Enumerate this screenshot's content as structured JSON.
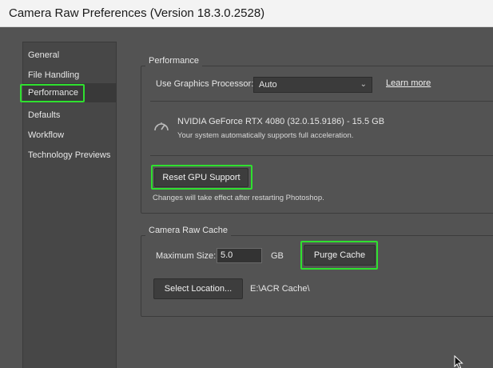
{
  "window": {
    "title": "Camera Raw Preferences  (Version 18.3.0.2528)"
  },
  "sidebar": {
    "items": [
      {
        "label": "General"
      },
      {
        "label": "File Handling"
      },
      {
        "label": "Performance"
      },
      {
        "label": "Defaults"
      },
      {
        "label": "Workflow"
      },
      {
        "label": "Technology Previews"
      }
    ],
    "selected": "Performance"
  },
  "performance": {
    "group_title": "Performance",
    "gpu_label": "Use Graphics Processor:",
    "gpu_value": "Auto",
    "learn_more": "Learn more",
    "gpu_name": "NVIDIA GeForce RTX 4080 (32.0.15.9186) - 15.5 GB",
    "gpu_status": "Your system automatically supports full acceleration.",
    "reset_button": "Reset GPU Support",
    "restart_note": "Changes will take effect after restarting Photoshop."
  },
  "cache": {
    "group_title": "Camera Raw Cache",
    "max_size_label": "Maximum Size:",
    "max_size_value": "5.0",
    "unit": "GB",
    "purge_button": "Purge Cache",
    "select_location_button": "Select Location...",
    "location_path": "E:\\ACR Cache\\"
  },
  "colors": {
    "highlight": "#2fe02f",
    "panel": "#535353",
    "sidebar": "#474747"
  },
  "icons": [
    "gauge-icon",
    "chevron-down-icon",
    "mouse-cursor-icon"
  ]
}
